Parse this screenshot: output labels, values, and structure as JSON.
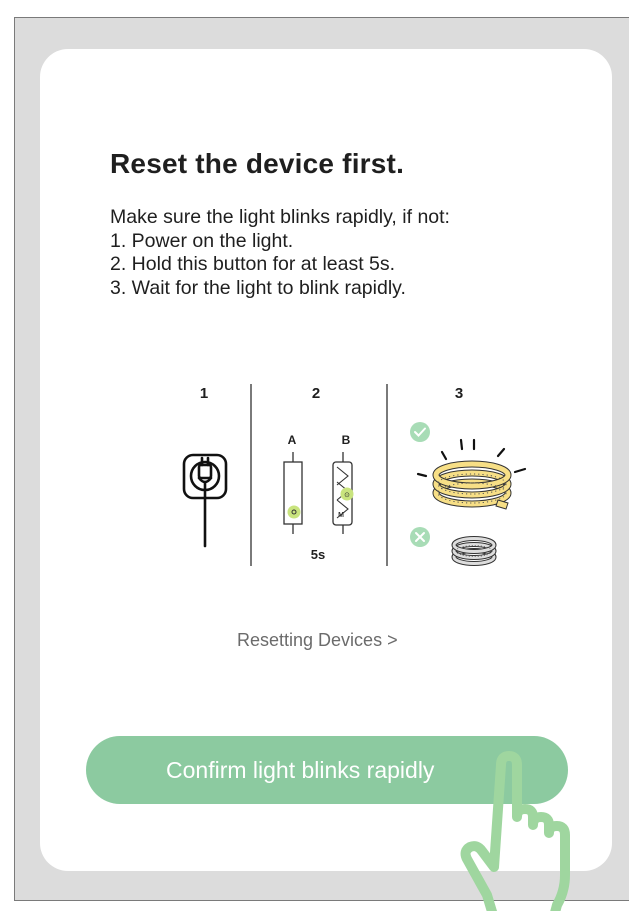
{
  "dialog": {
    "title": "Reset the device first.",
    "instructions": [
      "Make sure the light blinks rapidly, if not:",
      "1. Power on the light.",
      "2. Hold this button for at least 5s.",
      "3. Wait for the light to blink rapidly."
    ],
    "diagram": {
      "step_numbers": [
        "1",
        "2",
        "3"
      ],
      "device_labels": [
        "A",
        "B"
      ],
      "hold_duration": "5s",
      "button_b_labels": [
        "M",
        "⊙"
      ]
    },
    "link_text": "Resetting Devices >",
    "confirm_label": "Confirm light blinks rapidly"
  },
  "colors": {
    "accent_green": "#8ccaa0",
    "check_green": "#a8dcb6",
    "strip_yellow": "#f7df86",
    "frame_gray": "#dcdcdc"
  },
  "icons": [
    "plug-socket-icon",
    "check-icon",
    "cross-icon",
    "led-strip-icon",
    "tap-hand-icon"
  ]
}
